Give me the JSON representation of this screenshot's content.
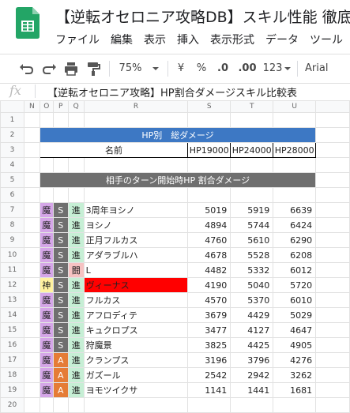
{
  "app": {
    "title": "【逆転オセロニア攻略DB】スキル性能 徹底比",
    "menu": [
      "ファイル",
      "編集",
      "表示",
      "挿入",
      "表示形式",
      "データ",
      "ツール"
    ]
  },
  "toolbar": {
    "zoom": "75%",
    "currency": "¥",
    "percent": "%",
    "dec_decrease": ".0",
    "dec_increase": ".00",
    "more_formats": "123",
    "font": "Arial"
  },
  "formula": {
    "fx": "fx",
    "text": "【逆転オセロニア攻略】HP割合ダメージスキル比較表"
  },
  "columns": [
    "N",
    "O",
    "P",
    "Q",
    "R",
    "S",
    "T",
    "U"
  ],
  "section1_title": "HP別　総ダメージ",
  "header": {
    "name": "名前",
    "hp1": "HP19000",
    "hp2": "HP24000",
    "hp3": "HP28000"
  },
  "section2_title": "相手のターン開始時HP 割合ダメージ",
  "colors": {
    "band": "#3d78c4",
    "band2": "#6f6f6f",
    "type_ma": "#d5a6e8",
    "type_kami": "#fff2a0",
    "rank_s": "#6f6f6f",
    "rank_a": "#e57c36",
    "ev_shin": "#c6efd5",
    "ev_gai": "#f6c2c2",
    "highlight": "#ff0000"
  },
  "rows": [
    {
      "n": "7",
      "type": "魔",
      "type_color": "type_ma",
      "rank": "S",
      "rank_color": "rank_s",
      "ev": "進",
      "ev_color": "ev_shin",
      "name": "3周年ヨシノ",
      "v1": "5019",
      "v2": "5919",
      "v3": "6639"
    },
    {
      "n": "8",
      "type": "魔",
      "type_color": "type_ma",
      "rank": "S",
      "rank_color": "rank_s",
      "ev": "進",
      "ev_color": "ev_shin",
      "name": "ヨシノ",
      "v1": "4894",
      "v2": "5744",
      "v3": "6424"
    },
    {
      "n": "9",
      "type": "魔",
      "type_color": "type_ma",
      "rank": "S",
      "rank_color": "rank_s",
      "ev": "進",
      "ev_color": "ev_shin",
      "name": "正月フルカス",
      "v1": "4760",
      "v2": "5610",
      "v3": "6290"
    },
    {
      "n": "10",
      "type": "魔",
      "type_color": "type_ma",
      "rank": "S",
      "rank_color": "rank_s",
      "ev": "進",
      "ev_color": "ev_shin",
      "name": "アダラブルハ",
      "v1": "4678",
      "v2": "5528",
      "v3": "6208"
    },
    {
      "n": "11",
      "type": "魔",
      "type_color": "type_ma",
      "rank": "S",
      "rank_color": "rank_s",
      "ev": "闘",
      "ev_color": "ev_gai",
      "name": "L",
      "v1": "4482",
      "v2": "5332",
      "v3": "6012"
    },
    {
      "n": "12",
      "type": "神",
      "type_color": "type_kami",
      "rank": "S",
      "rank_color": "rank_s",
      "ev": "進",
      "ev_color": "ev_shin",
      "name": "ヴィーナス",
      "v1": "4190",
      "v2": "5040",
      "v3": "5720",
      "highlight": true
    },
    {
      "n": "13",
      "type": "魔",
      "type_color": "type_ma",
      "rank": "S",
      "rank_color": "rank_s",
      "ev": "進",
      "ev_color": "ev_shin",
      "name": "フルカス",
      "v1": "4570",
      "v2": "5370",
      "v3": "6010"
    },
    {
      "n": "14",
      "type": "魔",
      "type_color": "type_ma",
      "rank": "S",
      "rank_color": "rank_s",
      "ev": "進",
      "ev_color": "ev_shin",
      "name": "アフロディテ",
      "v1": "3679",
      "v2": "4429",
      "v3": "5029"
    },
    {
      "n": "15",
      "type": "魔",
      "type_color": "type_ma",
      "rank": "S",
      "rank_color": "rank_s",
      "ev": "進",
      "ev_color": "ev_shin",
      "name": "キュクロプス",
      "v1": "3477",
      "v2": "4127",
      "v3": "4647"
    },
    {
      "n": "16",
      "type": "魔",
      "type_color": "type_ma",
      "rank": "S",
      "rank_color": "rank_s",
      "ev": "進",
      "ev_color": "ev_shin",
      "name": "狩魔景",
      "v1": "3825",
      "v2": "4425",
      "v3": "4905"
    },
    {
      "n": "17",
      "type": "魔",
      "type_color": "type_ma",
      "rank": "A",
      "rank_color": "rank_a",
      "ev": "進",
      "ev_color": "ev_shin",
      "name": "クランプス",
      "v1": "3196",
      "v2": "3796",
      "v3": "4276"
    },
    {
      "n": "18",
      "type": "魔",
      "type_color": "type_ma",
      "rank": "A",
      "rank_color": "rank_a",
      "ev": "進",
      "ev_color": "ev_shin",
      "name": "ガズール",
      "v1": "2542",
      "v2": "2942",
      "v3": "3262"
    },
    {
      "n": "19",
      "type": "魔",
      "type_color": "type_ma",
      "rank": "A",
      "rank_color": "rank_a",
      "ev": "進",
      "ev_color": "ev_shin",
      "name": "ヨモツイクサ",
      "v1": "1141",
      "v2": "1441",
      "v3": "1681"
    }
  ]
}
